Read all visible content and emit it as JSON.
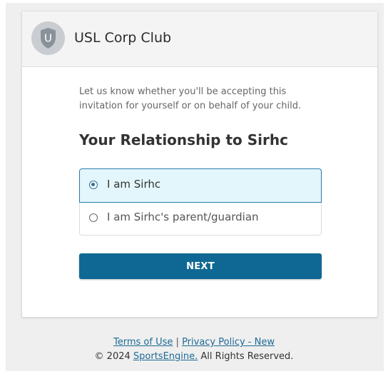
{
  "header": {
    "logo_letter": "U",
    "org_name": "USL Corp Club"
  },
  "main": {
    "intro_text": "Let us know whether you'll be accepting this invitation for yourself or on behalf of your child.",
    "heading": "Your Relationship to Sirhc",
    "options": [
      {
        "label": "I am Sirhc",
        "selected": true
      },
      {
        "label": "I am Sirhc's parent/guardian",
        "selected": false
      }
    ],
    "next_label": "NEXT"
  },
  "footer": {
    "terms_label": "Terms of Use",
    "separator": "|",
    "privacy_label": "Privacy Policy - New",
    "copyright_prefix": "© 2024",
    "brand_link": "SportsEngine.",
    "copyright_suffix": "All Rights Reserved."
  },
  "colors": {
    "accent": "#0f6893",
    "selected_bg": "#e3f6fc",
    "link": "#1d6a96"
  }
}
